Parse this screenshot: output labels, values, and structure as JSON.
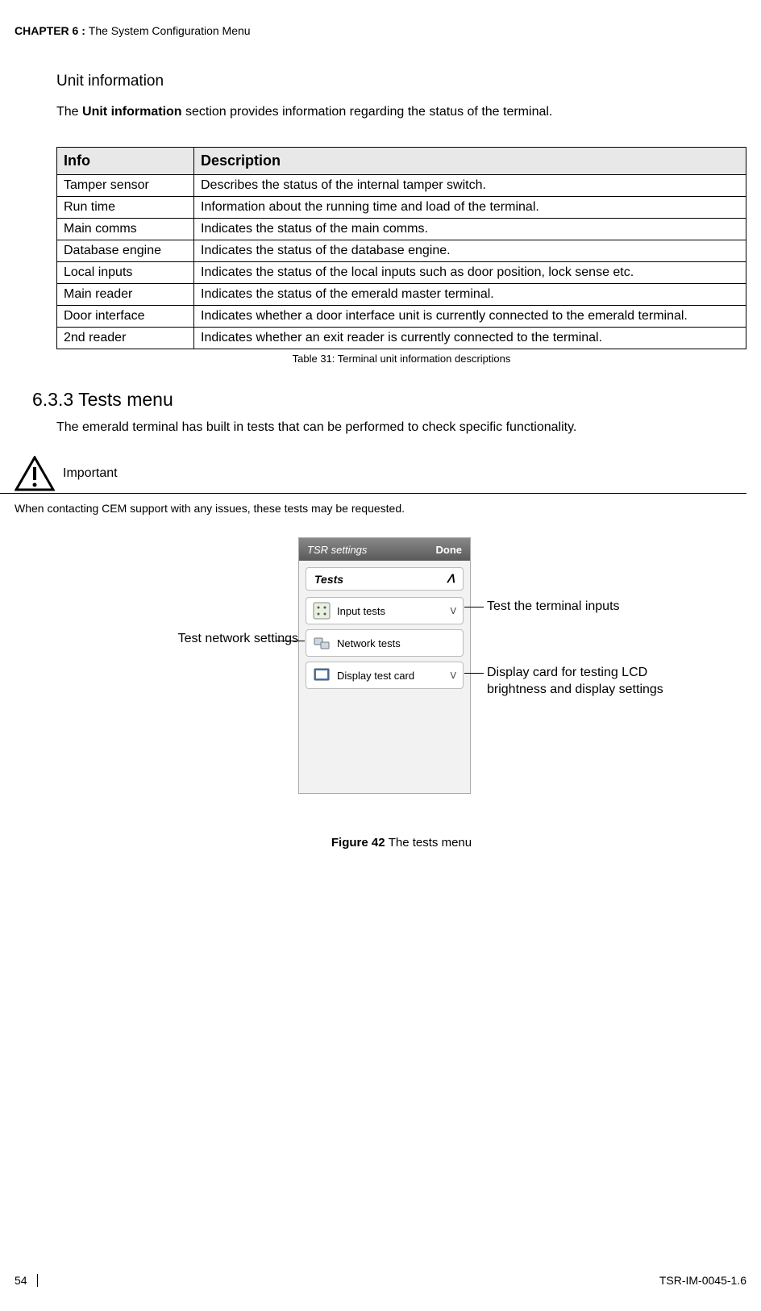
{
  "header": {
    "chapter_label": "CHAPTER  6 : ",
    "chapter_title": "The System Configuration Menu"
  },
  "section1": {
    "title": "Unit information",
    "intro_pre": "The ",
    "intro_bold": "Unit information",
    "intro_post": " section provides information regarding the status of the terminal."
  },
  "table": {
    "col_info": "Info",
    "col_desc": "Description",
    "rows": [
      {
        "info": "Tamper sensor",
        "desc": "Describes the status of the internal tamper switch."
      },
      {
        "info": "Run time",
        "desc": "Information about the running time and load of the terminal."
      },
      {
        "info": "Main comms",
        "desc": "Indicates the status of the main comms."
      },
      {
        "info": "Database engine",
        "desc": "Indicates the status of the database engine."
      },
      {
        "info": "Local inputs",
        "desc": "Indicates the status of the local inputs such as door position, lock sense etc."
      },
      {
        "info": "Main reader",
        "desc": "Indicates the status of the emerald master terminal."
      },
      {
        "info": "Door interface",
        "desc": "Indicates whether a door interface unit is currently connected to the emerald terminal."
      },
      {
        "info": "2nd reader",
        "desc": "Indicates whether an exit reader is currently connected to the terminal."
      }
    ],
    "caption": "Table 31: Terminal unit information descriptions"
  },
  "section2": {
    "number_title": "6.3.3  Tests menu",
    "intro": "The emerald terminal has built in tests that can be performed to check specific functionality.",
    "important_label": "Important",
    "important_text": "When contacting CEM support with any issues, these tests may be requested."
  },
  "device": {
    "titlebar": "TSR settings",
    "done": "Done",
    "section": "Tests",
    "caret_up": "ᐱ",
    "caret_down": "ᐯ",
    "items": [
      {
        "label": "Input tests"
      },
      {
        "label": "Network tests"
      },
      {
        "label": "Display test card"
      }
    ]
  },
  "callouts": {
    "left": "Test network settings",
    "right1": "Test the terminal inputs",
    "right2": "Display card for testing LCD brightness and display settings"
  },
  "figure": {
    "label": "Figure 42 ",
    "title": "The tests menu"
  },
  "footer": {
    "page": "54",
    "code": "TSR-IM-0045-1.6"
  }
}
